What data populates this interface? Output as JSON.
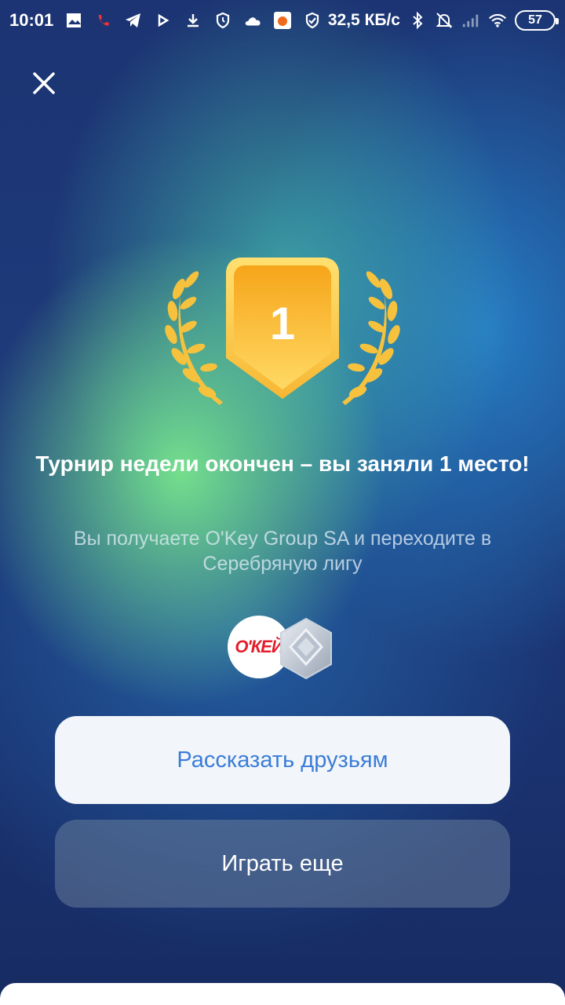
{
  "status_bar": {
    "time": "10:01",
    "net_speed": "32,5 КБ/с",
    "battery": "57",
    "icons": [
      "photo-icon",
      "missed-call-icon",
      "telegram-icon",
      "play-icon",
      "download-icon",
      "shield-icon",
      "cloud-icon",
      "app-icon",
      "shield-check-icon",
      "bluetooth-icon",
      "mute-icon",
      "signal-icon",
      "wifi-icon",
      "battery-icon"
    ]
  },
  "award": {
    "place": "1",
    "colors": {
      "gold": "#f7b733",
      "gold_light": "#ffd45c",
      "laurel": "#f6c23e"
    }
  },
  "result": {
    "title": "Турнир недели окончен – вы заняли 1 место!",
    "subtitle": "Вы получаете O'Key Group SA и переходите в Серебряную лигу"
  },
  "badges": {
    "company_logo_text": "О'КЕЙ",
    "league": "silver-league-icon"
  },
  "actions": {
    "share_label": "Рассказать друзьям",
    "play_again_label": "Играть еще"
  },
  "colors": {
    "accent": "#3b7dd8",
    "background": "#1c3473"
  }
}
